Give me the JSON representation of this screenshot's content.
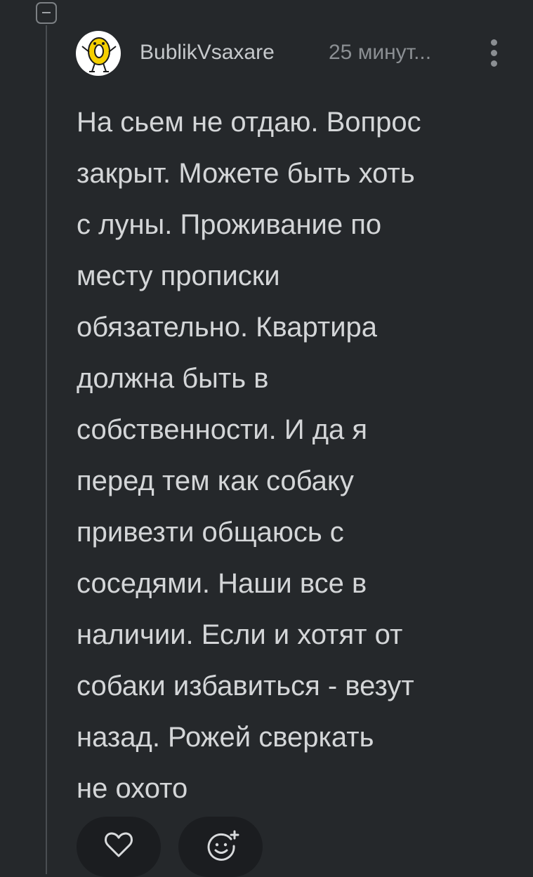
{
  "comment": {
    "author": "BublikVsaxare",
    "time": "25 минут...",
    "text": "На сьем не отдаю. Вопрос\nзакрыт. Можете быть хоть\nс луны. Проживание по\nместу прописки\nобязательно. Квартира\nдолжна быть в\nсобственности. И да я\nперед тем как собаку\nпривезти общаюсь с\nсоседями. Наши все в\nналичии. Если и хотят от\nсобаки избавиться - везут\nназад. Рожей сверкать\nне охото"
  },
  "icons": {
    "collapse": "minus-square-icon",
    "more": "vertical-dots-icon",
    "like": "heart-icon",
    "react": "smiley-plus-icon"
  },
  "colors": {
    "background": "#25282b",
    "text": "#d4d6d8",
    "muted": "#8b8f93",
    "button_bg": "#1b1d20",
    "avatar_accent": "#f5d000"
  }
}
